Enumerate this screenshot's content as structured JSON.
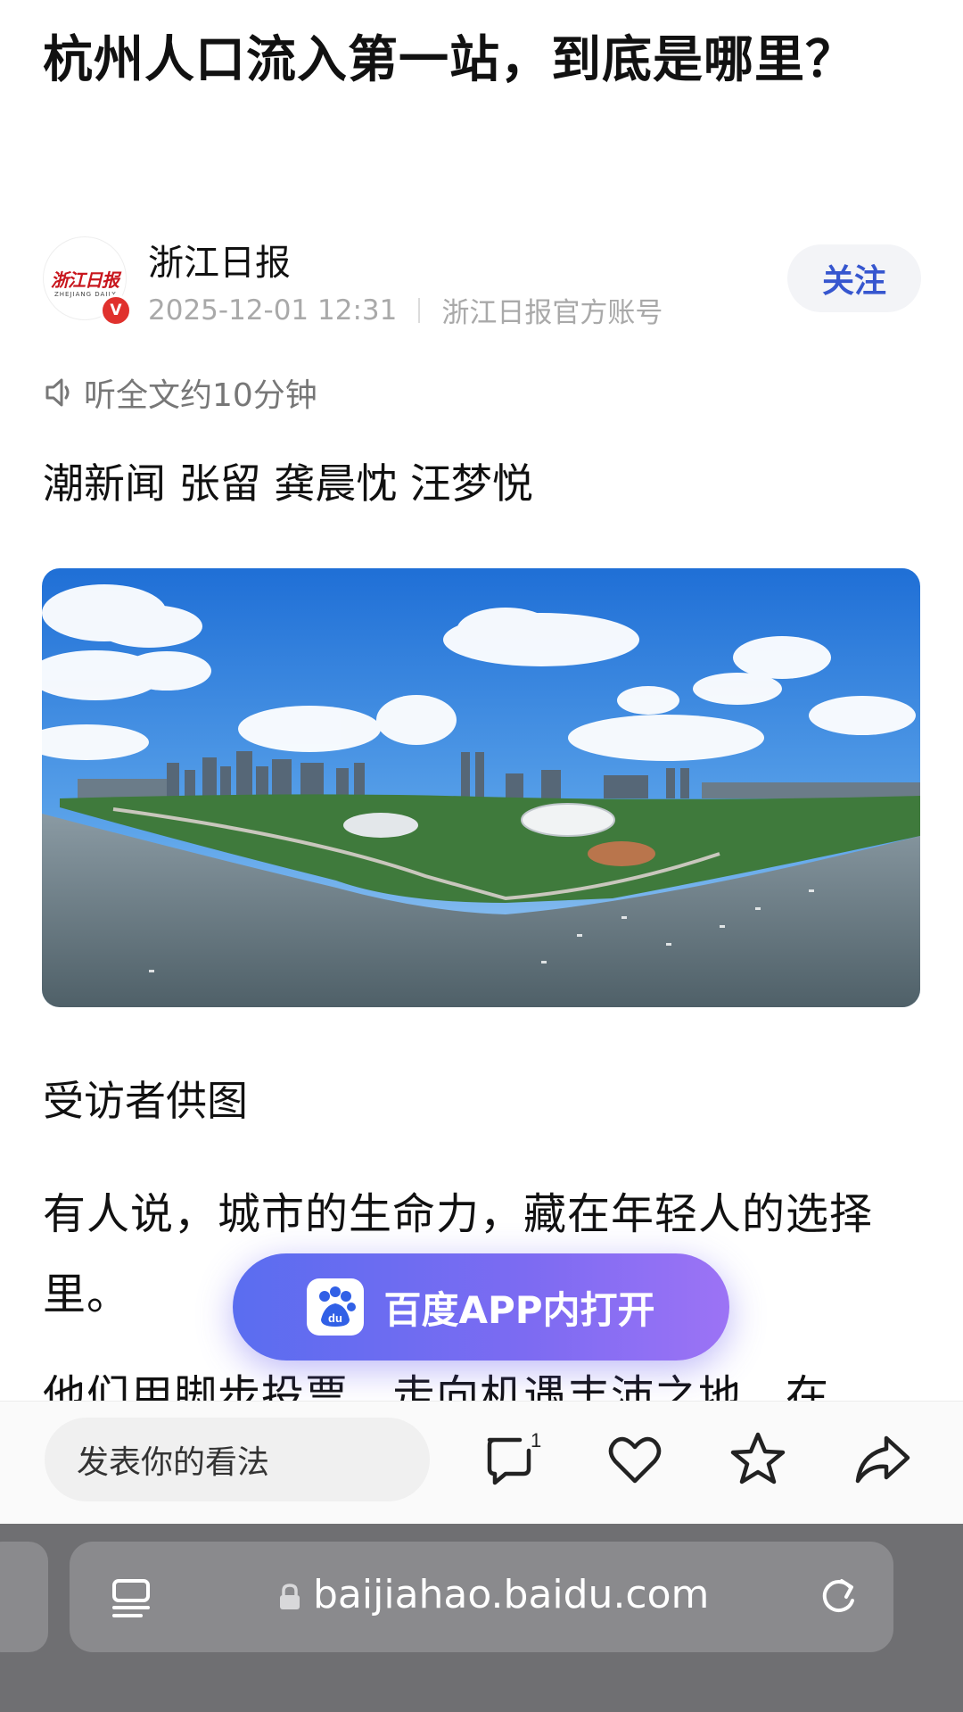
{
  "article": {
    "title": "杭州人口流入第一站，到底是哪里？",
    "account_name": "浙江日报",
    "date": "2025-12-01 12:31",
    "account_desc": "浙江日报官方账号",
    "follow_label": "关注",
    "listen_label": "听全文约10分钟",
    "authors": "潮新闻 张留 龚晨忱 汪梦悦",
    "image_caption": "受访者供图",
    "para1": "有人说，城市的生命力，藏在年轻人的选择里。",
    "para2": "他们用脚步投票，走向机遇丰沛之地，在"
  },
  "logo": {
    "text": "浙江日报",
    "subtext": "ZHEJIANG DAILY",
    "badge": "V"
  },
  "open_app": {
    "label": "百度APP内打开",
    "icon_text": "du"
  },
  "bottom_bar": {
    "comment_placeholder": "发表你的看法",
    "comment_count": "1",
    "icons": [
      "comment-icon",
      "heart-icon",
      "star-icon",
      "share-icon"
    ]
  },
  "browser": {
    "url": "baijiahao.baidu.com"
  },
  "colors": {
    "accent": "#3656cf",
    "verified_badge": "#e0312d",
    "open_app_gradient_start": "#5a6df0",
    "open_app_gradient_end": "#9c73f5",
    "browser_chrome": "#6f6f72"
  }
}
